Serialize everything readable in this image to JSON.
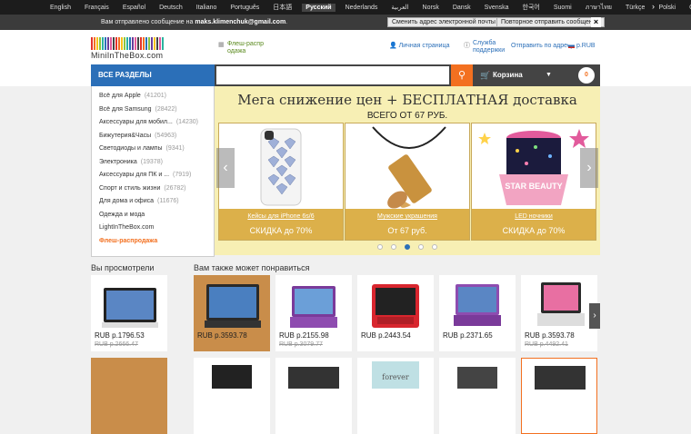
{
  "languages": [
    "English",
    "Français",
    "Español",
    "Deutsch",
    "Italiano",
    "Português",
    "日本語",
    "Русский",
    "Nederlands",
    "العربية",
    "Norsk",
    "Dansk",
    "Svenska",
    "한국어",
    "Suomi",
    "ภาษาไทย",
    "Türkçe",
    "Polski",
    "Čeština"
  ],
  "active_language": "Русский",
  "notice": {
    "text_before": "Вам отправлено сообщение на ",
    "email": "maks.klimenchuk@gmail.com",
    "change_email": "Сменить адрес электронной почты",
    "resend": "Повторное отправить сообщение"
  },
  "logo_text": "MiniInTheBox.com",
  "flash_sale_header": "Флеш-распр одажа",
  "header_links": {
    "account": "Личная страница",
    "support": "Служба поддержки",
    "ship_to": "Отправить по адресу",
    "currency": "р.RUB"
  },
  "nav": {
    "all_sections": "ВСЕ РАЗДЕЛЫ",
    "cart": "Корзина",
    "cart_count": "0"
  },
  "categories": [
    {
      "name": "Всё для Apple",
      "count": "(41201)"
    },
    {
      "name": "Всё для Samsung",
      "count": "(28422)"
    },
    {
      "name": "Аксессуары для мобил...",
      "count": "(14230)"
    },
    {
      "name": "Бижутерия&Часы",
      "count": "(54963)"
    },
    {
      "name": "Светодиоды и лампы",
      "count": "(9341)"
    },
    {
      "name": "Электроника",
      "count": "(19378)"
    },
    {
      "name": "Аксессуары для ПК и ...",
      "count": "(7919)"
    },
    {
      "name": "Спорт и стиль жизни",
      "count": "(26782)"
    },
    {
      "name": "Для дома и офиса",
      "count": "(11676)"
    },
    {
      "name": "Одежда и мода",
      "count": ""
    },
    {
      "name": "LightInTheBox.com",
      "count": ""
    },
    {
      "name": "Флеш-распродажа",
      "count": ""
    }
  ],
  "banner": {
    "title": "Мега снижение цен + БЕСПЛАТНАЯ доставка",
    "subtitle": "ВСЕГО ОТ 67 РУБ.",
    "cards": [
      {
        "label": "Кейсы для iPhone 6s/6",
        "offer": "СКИДКА до 70%"
      },
      {
        "label": "Мужские украшения",
        "offer": "От 67 руб."
      },
      {
        "label": "LED ночники",
        "offer": "СКИДКА до 70%"
      }
    ],
    "star_text": "STAR BEAUTY",
    "active_dot": 2
  },
  "viewed_title": "Вы просмотрели",
  "recommend_title": "Вам также может понравиться",
  "viewed": [
    {
      "price": "RUB р.1796.53",
      "old": "RUB р.2666.47"
    }
  ],
  "recommended": [
    {
      "price": "RUB р.3593.78",
      "old": ""
    },
    {
      "price": "RUB р.2155.98",
      "old": "RUB р.3079.77"
    },
    {
      "price": "RUB р.2443.54",
      "old": ""
    },
    {
      "price": "RUB р.2371.65",
      "old": ""
    },
    {
      "price": "RUB р.3593.78",
      "old": "RUB р.4492.41"
    }
  ],
  "colors": {
    "accent_orange": "#f37020",
    "brand_blue": "#2b6fb8",
    "banner_yellow": "#f7efb4"
  }
}
